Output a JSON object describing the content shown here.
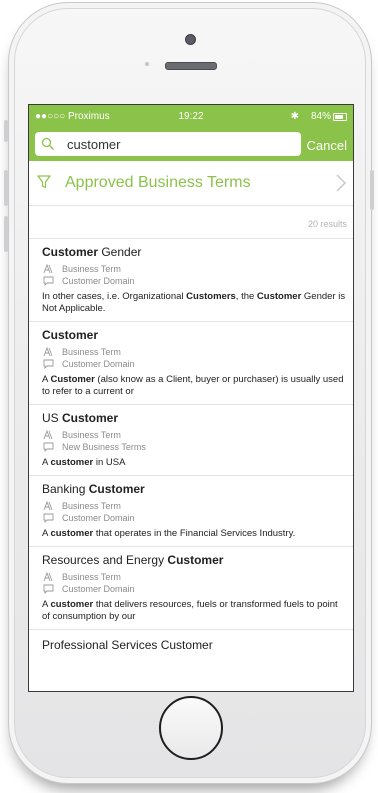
{
  "status_bar": {
    "carrier": "●●○○○ Proximus ",
    "time": "19:22",
    "battery": "84%"
  },
  "search": {
    "value": "customer",
    "cancel_label": "Cancel"
  },
  "filter": {
    "title": "Approved Business Terms"
  },
  "results_count": "20 results",
  "results": [
    {
      "title": [
        {
          "t": "Customer",
          "b": true
        },
        {
          "t": " Gender",
          "b": false
        }
      ],
      "type": "Business Term",
      "domain": "Customer Domain",
      "desc": [
        {
          "t": "In other cases, i.e. Organizational ",
          "b": false
        },
        {
          "t": "Customers",
          "b": true
        },
        {
          "t": ", the ",
          "b": false
        },
        {
          "t": "Customer",
          "b": true
        },
        {
          "t": " Gender is Not Applicable.",
          "b": false
        }
      ]
    },
    {
      "title": [
        {
          "t": "Customer",
          "b": true
        }
      ],
      "type": "Business Term",
      "domain": "Customer Domain",
      "desc": [
        {
          "t": "A ",
          "b": false
        },
        {
          "t": "Customer",
          "b": true
        },
        {
          "t": " (also know as a Client, buyer or purchaser) is usually used to refer to a current or",
          "b": false
        }
      ]
    },
    {
      "title": [
        {
          "t": "US ",
          "b": false
        },
        {
          "t": "Customer",
          "b": true
        }
      ],
      "type": "Business Term",
      "domain": "New Business Terms",
      "desc": [
        {
          "t": "A ",
          "b": false
        },
        {
          "t": "customer",
          "b": true
        },
        {
          "t": " in USA",
          "b": false
        }
      ]
    },
    {
      "title": [
        {
          "t": "Banking ",
          "b": false
        },
        {
          "t": "Customer",
          "b": true
        }
      ],
      "type": "Business Term",
      "domain": "Customer Domain",
      "desc": [
        {
          "t": "A ",
          "b": false
        },
        {
          "t": "customer",
          "b": true
        },
        {
          "t": " that operates in the Financial Services Industry.",
          "b": false
        }
      ]
    },
    {
      "title": [
        {
          "t": "Resources and Energy ",
          "b": false
        },
        {
          "t": "Customer",
          "b": true
        }
      ],
      "type": "Business Term",
      "domain": "Customer Domain",
      "desc": [
        {
          "t": "A ",
          "b": false
        },
        {
          "t": "customer",
          "b": true
        },
        {
          "t": " that delivers resources, fuels or transformed fuels to point of consumption by our",
          "b": false
        }
      ]
    }
  ],
  "cut_off_item": "Professional Services Customer",
  "colors": {
    "accent": "#8bc34a",
    "meta_text": "#8c8c8c",
    "divider": "#e3e3e3"
  },
  "icons": {
    "type_icon": "business-term-icon",
    "domain_icon": "speech-bubble-icon"
  }
}
